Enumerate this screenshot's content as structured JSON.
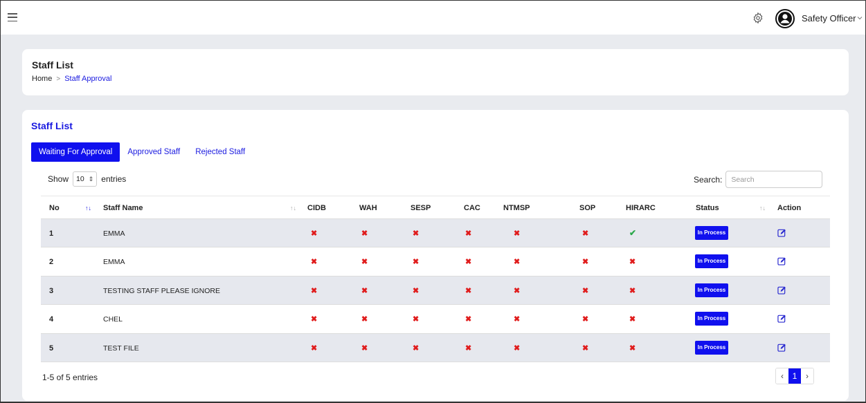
{
  "topbar": {
    "user_name": "Safety Officer",
    "icons": {
      "menu": "hamburger-icon",
      "settings": "gear-icon",
      "avatar": "user-circle-icon",
      "dropdown": "chevron-down-icon"
    }
  },
  "header": {
    "title": "Staff List",
    "breadcrumb": {
      "home": "Home",
      "separator": ">",
      "current": "Staff Approval"
    }
  },
  "main": {
    "title": "Staff List",
    "tabs": [
      {
        "label": "Waiting For Approval",
        "active": true
      },
      {
        "label": "Approved Staff",
        "active": false
      },
      {
        "label": "Rejected Staff",
        "active": false
      }
    ],
    "show_label": "Show",
    "entries_value": "10",
    "entries_label": "entries",
    "search_label": "Search:",
    "search_placeholder": "Search",
    "columns": [
      "No",
      "Staff Name",
      "CIDB",
      "WAH",
      "SESP",
      "CAC",
      "NTMSP",
      "SOP",
      "HIRARC",
      "Status",
      "Action"
    ],
    "rows": [
      {
        "no": "1",
        "name": "EMMA",
        "checks": [
          false,
          false,
          false,
          false,
          false,
          false,
          true
        ],
        "status": "In Process"
      },
      {
        "no": "2",
        "name": "EMMA",
        "checks": [
          false,
          false,
          false,
          false,
          false,
          false,
          false
        ],
        "status": "In Process"
      },
      {
        "no": "3",
        "name": "TESTING STAFF PLEASE IGNORE",
        "checks": [
          false,
          false,
          false,
          false,
          false,
          false,
          false
        ],
        "status": "In Process"
      },
      {
        "no": "4",
        "name": "CHEL",
        "checks": [
          false,
          false,
          false,
          false,
          false,
          false,
          false
        ],
        "status": "In Process"
      },
      {
        "no": "5",
        "name": "TEST FILE",
        "checks": [
          false,
          false,
          false,
          false,
          false,
          false,
          false
        ],
        "status": "In Process"
      }
    ],
    "footer_info": "1-5 of 5 entries",
    "pagination": {
      "prev": "‹",
      "current": "1",
      "next": "›"
    },
    "colors": {
      "accent": "#1010ee",
      "cross": "#e01c1c",
      "check": "#2aa84a"
    }
  }
}
